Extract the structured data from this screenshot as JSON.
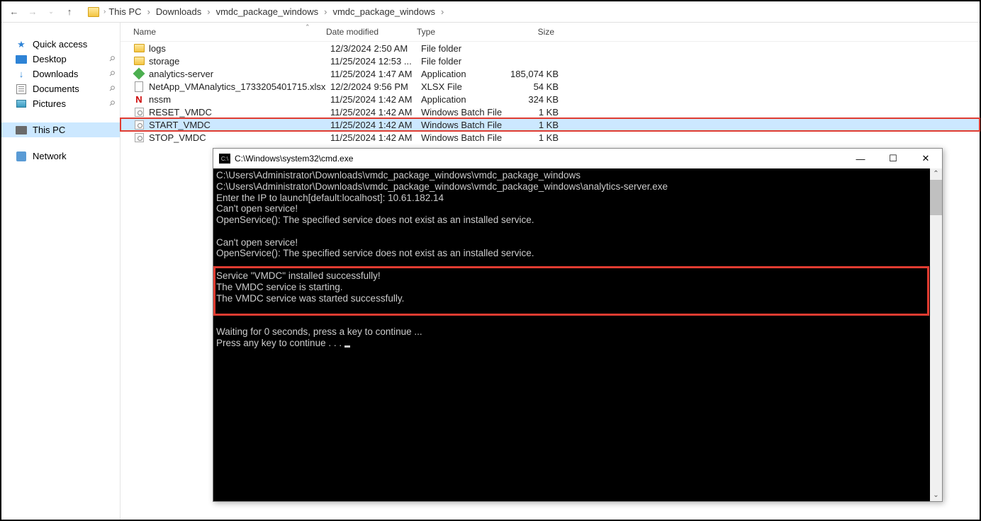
{
  "breadcrumb": {
    "items": [
      "This PC",
      "Downloads",
      "vmdc_package_windows",
      "vmdc_package_windows"
    ]
  },
  "sidebar": {
    "quick": "Quick access",
    "desktop": "Desktop",
    "downloads": "Downloads",
    "documents": "Documents",
    "pictures": "Pictures",
    "thispc": "This PC",
    "network": "Network"
  },
  "columns": {
    "name": "Name",
    "date": "Date modified",
    "type": "Type",
    "size": "Size"
  },
  "files": [
    {
      "icon": "folder",
      "name": "logs",
      "date": "12/3/2024 2:50 AM",
      "type": "File folder",
      "size": ""
    },
    {
      "icon": "folder",
      "name": "storage",
      "date": "11/25/2024 12:53 ...",
      "type": "File folder",
      "size": ""
    },
    {
      "icon": "app",
      "name": "analytics-server",
      "date": "11/25/2024 1:47 AM",
      "type": "Application",
      "size": "185,074 KB"
    },
    {
      "icon": "doc",
      "name": "NetApp_VMAnalytics_1733205401715.xlsx",
      "date": "12/2/2024 9:56 PM",
      "type": "XLSX File",
      "size": "54 KB"
    },
    {
      "icon": "n",
      "name": "nssm",
      "date": "11/25/2024 1:42 AM",
      "type": "Application",
      "size": "324 KB"
    },
    {
      "icon": "bat",
      "name": "RESET_VMDC",
      "date": "11/25/2024 1:42 AM",
      "type": "Windows Batch File",
      "size": "1 KB"
    },
    {
      "icon": "bat",
      "name": "START_VMDC",
      "date": "11/25/2024 1:42 AM",
      "type": "Windows Batch File",
      "size": "1 KB",
      "highlight": true,
      "selected": true
    },
    {
      "icon": "bat",
      "name": "STOP_VMDC",
      "date": "11/25/2024 1:42 AM",
      "type": "Windows Batch File",
      "size": "1 KB"
    }
  ],
  "cmd": {
    "title": "C:\\Windows\\system32\\cmd.exe",
    "lines": [
      "C:\\Users\\Administrator\\Downloads\\vmdc_package_windows\\vmdc_package_windows",
      "C:\\Users\\Administrator\\Downloads\\vmdc_package_windows\\vmdc_package_windows\\analytics-server.exe",
      "Enter the IP to launch[default:localhost]: 10.61.182.14",
      "Can't open service!",
      "OpenService(): The specified service does not exist as an installed service.",
      "",
      "Can't open service!",
      "OpenService(): The specified service does not exist as an installed service.",
      "",
      "Service \"VMDC\" installed successfully!",
      "The VMDC service is starting.",
      "The VMDC service was started successfully.",
      "",
      "",
      "Waiting for 0 seconds, press a key to continue ...",
      "Press any key to continue . . . "
    ]
  }
}
